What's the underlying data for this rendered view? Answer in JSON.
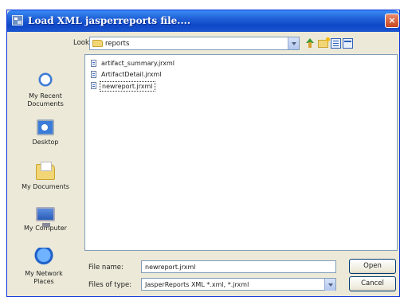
{
  "window": {
    "title": "Load XML jasperreports file....",
    "close_glyph": "×"
  },
  "lookin": {
    "label": "Look in:",
    "value": "reports"
  },
  "places": [
    {
      "label": "My Recent Documents",
      "icon": "recent-documents-icon"
    },
    {
      "label": "Desktop",
      "icon": "desktop-icon"
    },
    {
      "label": "My Documents",
      "icon": "my-documents-icon"
    },
    {
      "label": "My Computer",
      "icon": "my-computer-icon"
    },
    {
      "label": "My Network Places",
      "icon": "network-places-icon"
    }
  ],
  "files": [
    {
      "name": "artifact_summary.jrxml",
      "selected": false
    },
    {
      "name": "ArtifactDetail.jrxml",
      "selected": false
    },
    {
      "name": "newreport.jrxml",
      "selected": true
    }
  ],
  "filename": {
    "label": "File name:",
    "value": "newreport.jrxml"
  },
  "filetype": {
    "label": "Files of type:",
    "value": "JasperReports XML *.xml, *.jrxml"
  },
  "buttons": {
    "open": "Open",
    "cancel": "Cancel"
  }
}
